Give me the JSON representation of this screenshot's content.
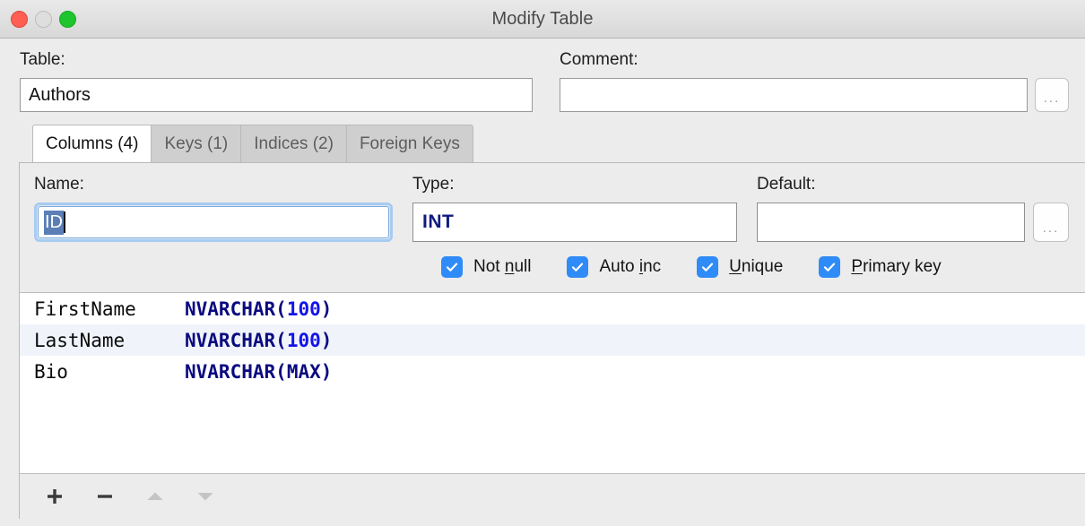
{
  "window": {
    "title": "Modify Table",
    "traffic_lights": [
      {
        "name": "close",
        "color": "#ff5f52"
      },
      {
        "name": "minimize",
        "color": "#dedede"
      },
      {
        "name": "zoom",
        "color": "#1fc52e"
      }
    ]
  },
  "topform": {
    "table": {
      "label": "Table:",
      "value": "Authors",
      "placeholder": ""
    },
    "comment": {
      "label": "Comment:",
      "value": "",
      "placeholder": "",
      "browse_label": "..."
    }
  },
  "tabs": [
    {
      "label": "Columns (4)",
      "active": true
    },
    {
      "label": "Keys (1)",
      "active": false
    },
    {
      "label": "Indices (2)",
      "active": false
    },
    {
      "label": "Foreign Keys",
      "active": false
    }
  ],
  "editor": {
    "name": {
      "label": "Name:",
      "value": "ID",
      "selected": true,
      "focused": true
    },
    "type": {
      "label": "Type:",
      "value": "INT"
    },
    "default": {
      "label": "Default:",
      "value": "",
      "placeholder": "",
      "browse_label": "..."
    },
    "checkboxes": [
      {
        "label": "Not null",
        "pre": "Not ",
        "mnemonic": "n",
        "post": "ull",
        "checked": true
      },
      {
        "label": "Auto inc",
        "pre": "Auto ",
        "mnemonic": "i",
        "post": "nc",
        "checked": true
      },
      {
        "label": "Unique",
        "pre": "",
        "mnemonic": "U",
        "post": "nique",
        "checked": true
      },
      {
        "label": "Primary key",
        "pre": "",
        "mnemonic": "P",
        "post": "rimary key",
        "checked": true
      }
    ]
  },
  "columns": [
    {
      "name": "FirstName",
      "type": "NVARCHAR",
      "arg": "100",
      "arg_kind": "number"
    },
    {
      "name": "LastName",
      "type": "NVARCHAR",
      "arg": "100",
      "arg_kind": "number"
    },
    {
      "name": "Bio",
      "type": "NVARCHAR",
      "arg": "MAX",
      "arg_kind": "keyword"
    }
  ],
  "toolbar": [
    {
      "name": "add-column",
      "glyph": "+",
      "enabled": true
    },
    {
      "name": "remove-column",
      "glyph": "−",
      "enabled": true
    },
    {
      "name": "move-up",
      "glyph": "▲",
      "enabled": false
    },
    {
      "name": "move-down",
      "glyph": "▼",
      "enabled": false
    }
  ],
  "colors": {
    "accent_checkbox": "#2f8bf7",
    "selection": "#5a7eb5",
    "type_keyword": "#0a0a80",
    "number_literal": "#1414e8",
    "alt_row": "#f0f4fa",
    "window_bg": "#ececec"
  }
}
